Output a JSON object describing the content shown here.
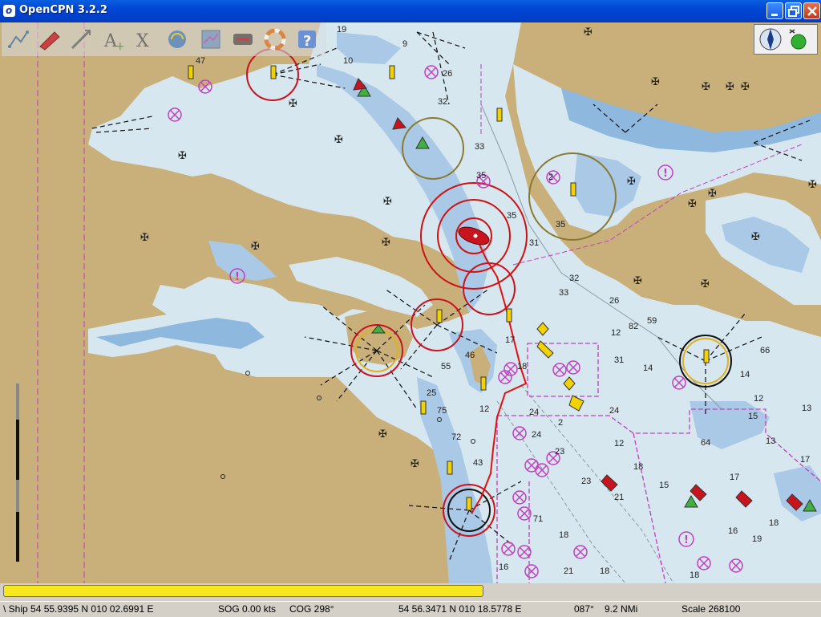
{
  "window": {
    "title": "OpenCPN 3.2.2",
    "app_icon": "opencpn-logo-icon"
  },
  "toolbar": {
    "items": [
      {
        "icon": "zoom-chart-icon"
      },
      {
        "icon": "ship-route-icon"
      },
      {
        "icon": "measure-tool-icon"
      },
      {
        "icon": "text-zoom-icon"
      },
      {
        "icon": "cross-hair-icon"
      },
      {
        "icon": "gps-connection-icon"
      },
      {
        "icon": "chart-bar-icon"
      },
      {
        "icon": "track-icon"
      },
      {
        "icon": "mob-icon"
      },
      {
        "icon": "help-icon"
      }
    ]
  },
  "chart": {
    "soundings": [
      "47",
      "19",
      "10",
      "26",
      "9",
      "32",
      "33",
      "35",
      "35",
      "31",
      "32",
      "33",
      "26",
      "12",
      "14",
      "22",
      "31",
      "14",
      "24",
      "2",
      "23",
      "12",
      "18",
      "15",
      "25",
      "17",
      "21",
      "16",
      "31",
      "35",
      "59",
      "66",
      "13",
      "14",
      "15",
      "23",
      "19",
      "17",
      "23",
      "18",
      "21",
      "9",
      "45",
      "55",
      "16",
      "36",
      "13"
    ],
    "colors": {
      "land": "#C9B07A",
      "water": "#D6E7EF",
      "shallow": "#8EB8DE",
      "deep_shallow": "#A9C9E6",
      "ownship": "#C8141E",
      "route": "#E01010",
      "boundary": "#C040C0"
    }
  },
  "compass": {
    "north_icon": "north-arrow-icon",
    "gps_icon": "gps-status-icon"
  },
  "status": {
    "ship": "\\ Ship 54 55.9395 N   010 02.6991 E",
    "sog": "SOG 0.00 kts",
    "cog": "COG 298°",
    "cursor": "54 56.3471 N   010 18.5778 E",
    "bearing": "087°",
    "distance": "9.2 NMi",
    "scale": "Scale 268100"
  },
  "progress": {
    "fraction": 0.59
  }
}
